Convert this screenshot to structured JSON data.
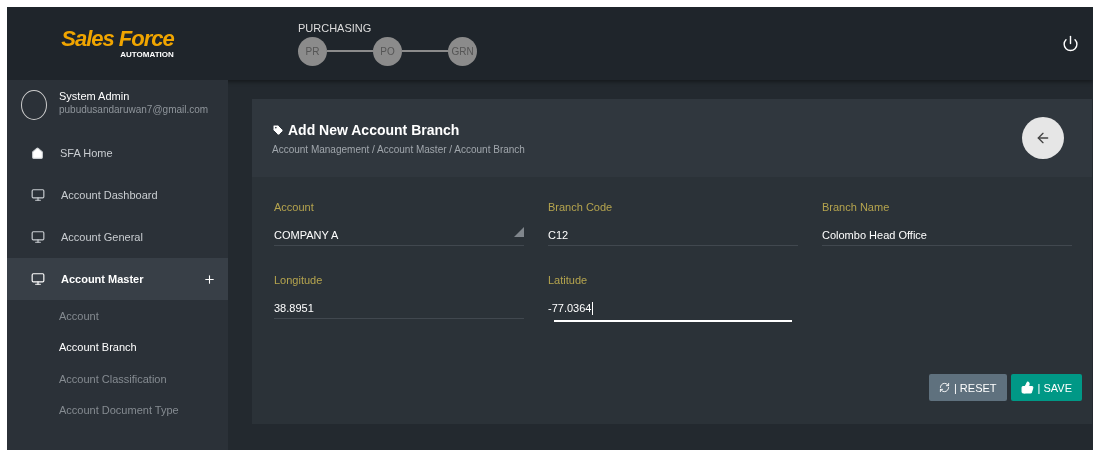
{
  "header": {
    "logo": {
      "title": "Sales Force",
      "subtitle": "AUTOMATION"
    },
    "workflow": {
      "title": "PURCHASING",
      "steps": [
        "PR",
        "PO",
        "GRN"
      ]
    }
  },
  "user": {
    "name": "System Admin",
    "email": "pubudusandaruwan7@gmail.com"
  },
  "sidebar": {
    "items": [
      {
        "label": "SFA Home",
        "kind": "home",
        "selected": false
      },
      {
        "label": "Account Dashboard",
        "kind": "monitor",
        "selected": false
      },
      {
        "label": "Account General",
        "kind": "monitor",
        "selected": false
      },
      {
        "label": "Account Master",
        "kind": "monitor",
        "selected": true,
        "expanded": true,
        "children": [
          {
            "label": "Account",
            "selected": false
          },
          {
            "label": "Account Branch",
            "selected": true
          },
          {
            "label": "Account Classification",
            "selected": false
          },
          {
            "label": "Account Document Type",
            "selected": false
          }
        ]
      }
    ]
  },
  "card": {
    "title": "Add New Account Branch",
    "breadcrumb": "Account Management / Account Master / Account Branch",
    "fields": [
      {
        "label": "Account",
        "value": "COMPANY A",
        "kind": "select",
        "focused": false
      },
      {
        "label": "Branch Code",
        "value": "C12",
        "kind": "text",
        "focused": false
      },
      {
        "label": "Branch Name",
        "value": "Colombo Head Office",
        "kind": "text",
        "focused": false
      },
      {
        "label": "Longitude",
        "value": "38.8951",
        "kind": "text",
        "focused": false
      },
      {
        "label": "Latitude",
        "value": "-77.0364",
        "kind": "text",
        "focused": true
      }
    ],
    "buttons": [
      {
        "label": "| RESET",
        "kind": "reset"
      },
      {
        "label": "| SAVE",
        "kind": "save"
      }
    ]
  }
}
